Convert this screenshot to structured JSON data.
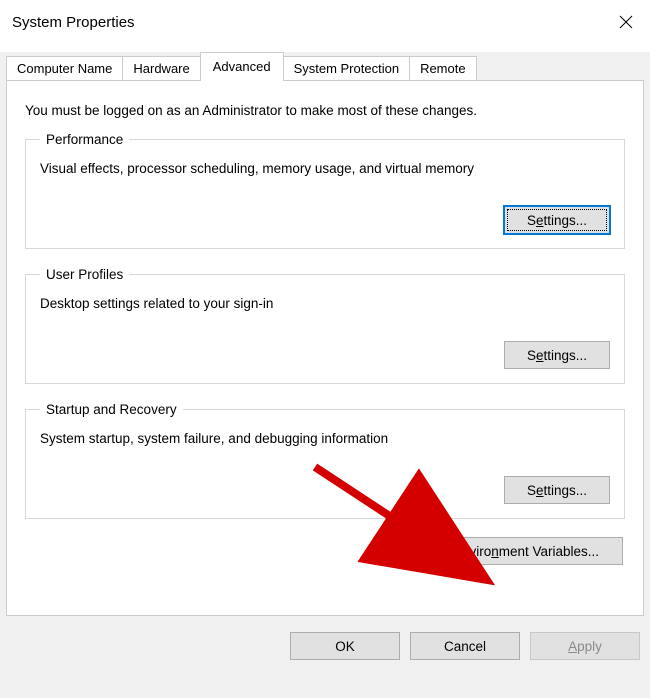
{
  "window": {
    "title": "System Properties"
  },
  "tabs": {
    "computer_name": "Computer Name",
    "hardware": "Hardware",
    "advanced": "Advanced",
    "system_protection": "System Protection",
    "remote": "Remote"
  },
  "advanced": {
    "intro": "You must be logged on as an Administrator to make most of these changes.",
    "performance": {
      "legend": "Performance",
      "desc": "Visual effects, processor scheduling, memory usage, and virtual memory",
      "button_prefix": "S",
      "button_mnemonic": "e",
      "button_suffix": "ttings..."
    },
    "userprofiles": {
      "legend": "User Profiles",
      "desc": "Desktop settings related to your sign-in",
      "button_prefix": "S",
      "button_mnemonic": "e",
      "button_suffix": "ttings..."
    },
    "startup": {
      "legend": "Startup and Recovery",
      "desc": "System startup, system failure, and debugging information",
      "button_prefix": "S",
      "button_mnemonic": "e",
      "button_suffix": "ttings..."
    },
    "env": {
      "prefix": "Enviro",
      "mnemonic": "n",
      "suffix": "ment Variables..."
    }
  },
  "footer": {
    "ok": "OK",
    "cancel": "Cancel",
    "apply_mnemonic": "A",
    "apply_suffix": "pply"
  }
}
